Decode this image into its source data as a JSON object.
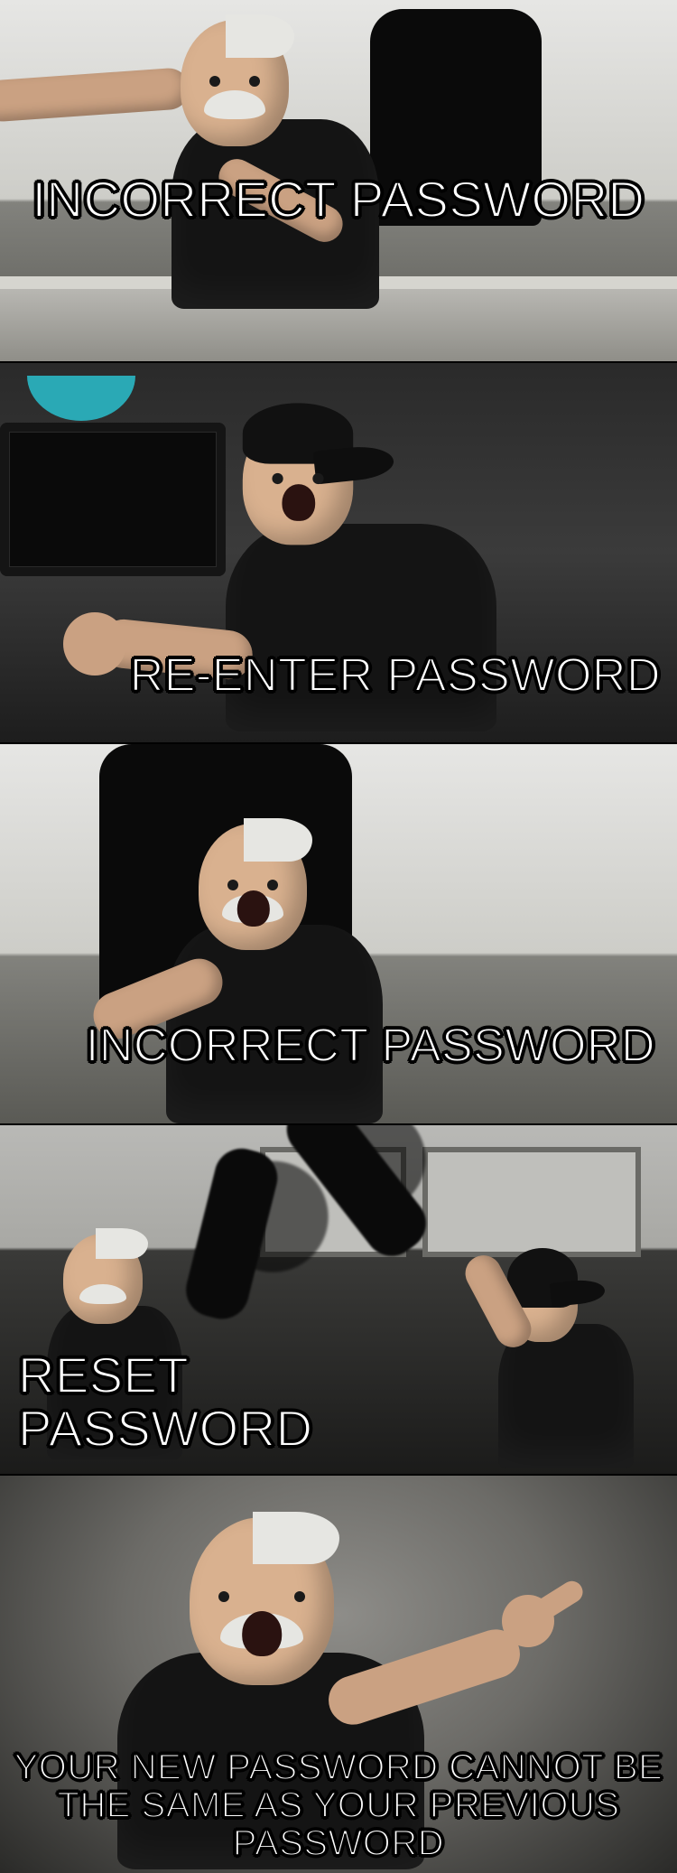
{
  "meme": {
    "template": "American Chopper Argument",
    "panels": [
      {
        "caption": "INCORRECT PASSWORD"
      },
      {
        "caption": "RE-ENTER PASSWORD"
      },
      {
        "caption": "INCORRECT PASSWORD"
      },
      {
        "caption": "RESET PASSWORD"
      },
      {
        "caption": "YOUR NEW PASSWORD CANNOT BE THE SAME AS YOUR PREVIOUS PASSWORD"
      }
    ]
  }
}
